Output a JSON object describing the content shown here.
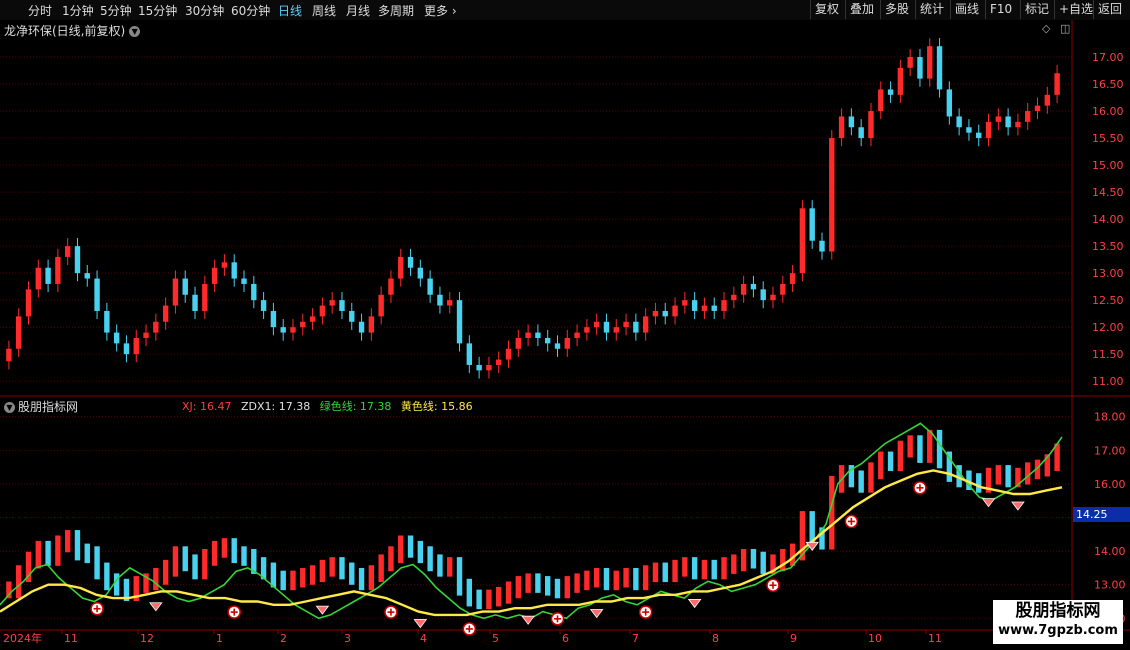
{
  "toolbar": {
    "tabs": [
      "分时",
      "1分钟",
      "5分钟",
      "15分钟",
      "30分钟",
      "60分钟",
      "日线",
      "周线",
      "月线",
      "多周期",
      "更多"
    ],
    "active_tab": "日线",
    "right_buttons": [
      "复权",
      "叠加",
      "多股",
      "统计",
      "画线",
      "F10",
      "标记",
      "+自选",
      "返回"
    ]
  },
  "stock": {
    "title": "龙净环保(日线,前复权)"
  },
  "indicator": {
    "name": "股朋指标网",
    "values": [
      {
        "label": "XJ: 16.47",
        "color": "#ff3b3b"
      },
      {
        "label": "ZDX1: 17.38",
        "color": "#e0e0e0"
      },
      {
        "label": "绿色线: 17.38",
        "color": "#37d437"
      },
      {
        "label": "黄色线: 15.86",
        "color": "#ffe94a"
      }
    ]
  },
  "cursor_price": "14.25",
  "x_axis": {
    "year_label": "2024年",
    "months": [
      "11",
      "12",
      "1",
      "2",
      "3",
      "4",
      "5",
      "6",
      "7",
      "8",
      "9",
      "10",
      "11"
    ]
  },
  "price_axis": [
    "17.00",
    "16.50",
    "16.00",
    "15.50",
    "15.00",
    "14.50",
    "14.00",
    "13.50",
    "13.00",
    "12.50",
    "12.00",
    "11.50",
    "11.00"
  ],
  "ind_axis": [
    "18.00",
    "17.00",
    "16.00",
    "15.00",
    "14.00",
    "13.00",
    "12.00"
  ],
  "watermark": {
    "line1": "股朋指标网",
    "line2": "www.7gpzb.com"
  },
  "colors": {
    "up": "#ff2a2a",
    "down": "#49d2f0",
    "green_line": "#37d437",
    "yellow_line": "#ffe94a",
    "grid": "#5a0000"
  },
  "chart_data": {
    "type": "candlestick",
    "price_range": [
      10.8,
      17.5
    ],
    "closes": [
      11.6,
      12.2,
      12.7,
      13.1,
      12.8,
      13.3,
      13.5,
      13.0,
      12.9,
      12.3,
      11.9,
      11.7,
      11.5,
      11.8,
      11.9,
      12.1,
      12.4,
      12.9,
      12.6,
      12.3,
      12.8,
      13.1,
      13.2,
      12.9,
      12.8,
      12.5,
      12.3,
      12.0,
      11.9,
      12.0,
      12.1,
      12.2,
      12.4,
      12.5,
      12.3,
      12.1,
      11.9,
      12.2,
      12.6,
      12.9,
      13.3,
      13.1,
      12.9,
      12.6,
      12.4,
      12.5,
      11.7,
      11.3,
      11.2,
      11.3,
      11.4,
      11.6,
      11.8,
      11.9,
      11.8,
      11.7,
      11.6,
      11.8,
      11.9,
      12.0,
      12.1,
      11.9,
      12.0,
      12.1,
      11.9,
      12.2,
      12.3,
      12.2,
      12.4,
      12.5,
      12.3,
      12.4,
      12.3,
      12.5,
      12.6,
      12.8,
      12.7,
      12.5,
      12.6,
      12.8,
      13.0,
      14.2,
      13.6,
      13.4,
      15.5,
      15.9,
      15.7,
      15.5,
      16.0,
      16.4,
      16.3,
      16.8,
      17.0,
      16.6,
      17.2,
      16.4,
      15.9,
      15.7,
      15.6,
      15.5,
      15.8,
      15.9,
      15.7,
      15.8,
      16.0,
      16.1,
      16.3,
      16.7
    ],
    "ind_range": [
      11.8,
      18.2
    ],
    "green_line": [
      12.4,
      12.8,
      13.1,
      13.5,
      13.6,
      13.2,
      12.9,
      12.6,
      12.5,
      12.7,
      13.2,
      13.5,
      13.3,
      13.1,
      12.8,
      12.6,
      12.5,
      12.6,
      12.8,
      13.0,
      13.4,
      13.5,
      13.3,
      13.0,
      12.7,
      12.4,
      12.2,
      12.0,
      12.1,
      12.3,
      12.5,
      12.7,
      12.9,
      13.2,
      13.5,
      13.6,
      13.3,
      12.9,
      12.6,
      12.3,
      12.1,
      12.0,
      12.1,
      12.0,
      12.1,
      12.0,
      12.2,
      12.1,
      12.0,
      12.3,
      12.4,
      12.6,
      12.7,
      12.5,
      12.4,
      12.6,
      12.8,
      12.7,
      12.6,
      12.9,
      13.1,
      13.0,
      12.8,
      12.9,
      13.0,
      13.2,
      13.4,
      13.5,
      13.9,
      14.3,
      14.8,
      16.0,
      16.4,
      16.6,
      16.9,
      17.2,
      17.4,
      17.6,
      17.8,
      17.5,
      17.0,
      16.5,
      16.0,
      15.6,
      15.5,
      15.7,
      15.9,
      16.2,
      16.5,
      16.9,
      17.4
    ],
    "yellow_line": [
      12.2,
      12.5,
      12.8,
      13.0,
      13.0,
      12.9,
      12.7,
      12.6,
      12.6,
      12.7,
      12.8,
      12.8,
      12.7,
      12.6,
      12.6,
      12.5,
      12.5,
      12.4,
      12.4,
      12.5,
      12.6,
      12.7,
      12.8,
      12.7,
      12.6,
      12.4,
      12.2,
      12.1,
      12.1,
      12.1,
      12.2,
      12.2,
      12.3,
      12.3,
      12.4,
      12.4,
      12.4,
      12.5,
      12.5,
      12.6,
      12.6,
      12.7,
      12.7,
      12.8,
      12.8,
      12.9,
      13.0,
      13.2,
      13.4,
      13.7,
      14.1,
      14.5,
      14.9,
      15.3,
      15.6,
      15.9,
      16.1,
      16.3,
      16.4,
      16.3,
      16.1,
      15.9,
      15.8,
      15.7,
      15.7,
      15.8,
      15.9
    ],
    "buy_signal_dates_index": [
      9,
      23,
      39,
      47,
      56,
      65,
      78,
      86,
      93
    ],
    "sell_signal_dates_index": [
      15,
      32,
      42,
      53,
      60,
      70,
      82,
      100,
      103
    ]
  }
}
